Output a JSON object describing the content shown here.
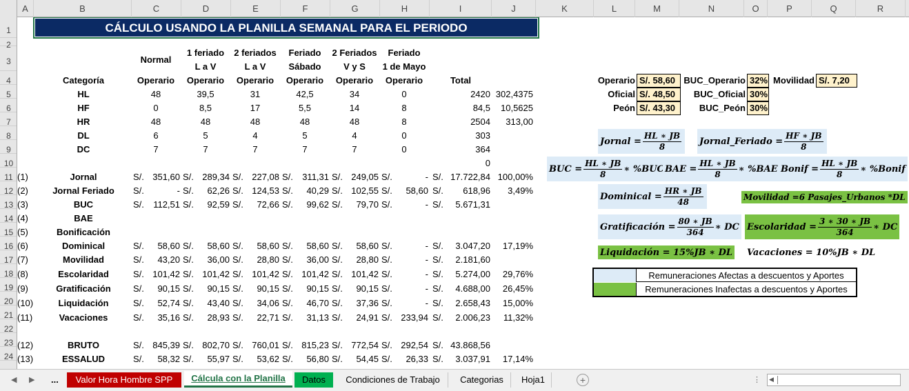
{
  "columns": [
    "A",
    "B",
    "C",
    "D",
    "E",
    "F",
    "G",
    "H",
    "I",
    "J",
    "K",
    "L",
    "M",
    "N",
    "O",
    "P",
    "Q",
    "R"
  ],
  "rows": [
    "1",
    "2",
    "3",
    "4",
    "5",
    "6",
    "7",
    "8",
    "9",
    "10",
    "11",
    "12",
    "13",
    "14",
    "15",
    "16",
    "17",
    "18",
    "19",
    "20",
    "21",
    "22",
    "23",
    "24"
  ],
  "title": "CÁLCULO USANDO LA PLANILLA SEMANAL PARA EL PERIODO",
  "headers": {
    "normal": "Normal",
    "f1a": "1 feriado",
    "f1b": "L a V",
    "f2a": "2 feriados",
    "f2b": "L a V",
    "fsa": "Feriado",
    "fsb": "Sábado",
    "fvsa": "2 Feriados",
    "fvsb": "V y S",
    "fma": "Feriado",
    "fmb": "1 de Mayo",
    "categoria": "Categoría",
    "operario": "Operario",
    "total": "Total"
  },
  "hours": [
    {
      "cat": "HL",
      "v": [
        "48",
        "39,5",
        "31",
        "42,5",
        "34",
        "0"
      ],
      "total": "2420",
      "j": "302,4375"
    },
    {
      "cat": "HF",
      "v": [
        "0",
        "8,5",
        "17",
        "5,5",
        "14",
        "8"
      ],
      "total": "84,5",
      "j": "10,5625"
    },
    {
      "cat": "HR",
      "v": [
        "48",
        "48",
        "48",
        "48",
        "48",
        "8"
      ],
      "total": "2504",
      "j": "313,00"
    },
    {
      "cat": "DL",
      "v": [
        "6",
        "5",
        "4",
        "5",
        "4",
        "0"
      ],
      "total": "303",
      "j": ""
    },
    {
      "cat": "DC",
      "v": [
        "7",
        "7",
        "7",
        "7",
        "7",
        "0"
      ],
      "total": "364",
      "j": ""
    }
  ],
  "row10_total": "0",
  "currency": "S/.",
  "items": [
    {
      "num": "(1)",
      "name": "Jornal",
      "v": [
        "351,60",
        "289,34",
        "227,08",
        "311,31",
        "249,05",
        "-"
      ],
      "total": "17.722,84",
      "pct": "100,00%"
    },
    {
      "num": "(2)",
      "name": "Jornal Feriado",
      "v": [
        "-",
        "62,26",
        "124,53",
        "40,29",
        "102,55",
        "58,60"
      ],
      "total": "618,96",
      "pct": "3,49%"
    },
    {
      "num": "(3)",
      "name": "BUC",
      "v": [
        "112,51",
        "92,59",
        "72,66",
        "99,62",
        "79,70",
        "-"
      ],
      "total": "5.671,31",
      "pct": ""
    },
    {
      "num": "(4)",
      "name": "BAE",
      "v": null,
      "total": "",
      "pct": ""
    },
    {
      "num": "(5)",
      "name": "Bonificación",
      "v": null,
      "total": "",
      "pct": ""
    },
    {
      "num": "(6)",
      "name": "Dominical",
      "v": [
        "58,60",
        "58,60",
        "58,60",
        "58,60",
        "58,60",
        "-"
      ],
      "total": "3.047,20",
      "pct": "17,19%"
    },
    {
      "num": "(7)",
      "name": "Movilidad",
      "v": [
        "43,20",
        "36,00",
        "28,80",
        "36,00",
        "28,80",
        "-"
      ],
      "total": "2.181,60",
      "pct": ""
    },
    {
      "num": "(8)",
      "name": "Escolaridad",
      "v": [
        "101,42",
        "101,42",
        "101,42",
        "101,42",
        "101,42",
        "-"
      ],
      "total": "5.274,00",
      "pct": "29,76%"
    },
    {
      "num": "(9)",
      "name": "Gratificación",
      "v": [
        "90,15",
        "90,15",
        "90,15",
        "90,15",
        "90,15",
        "-"
      ],
      "total": "4.688,00",
      "pct": "26,45%"
    },
    {
      "num": "(10)",
      "name": "Liquidación",
      "v": [
        "52,74",
        "43,40",
        "34,06",
        "46,70",
        "37,36",
        "-"
      ],
      "total": "2.658,43",
      "pct": "15,00%"
    },
    {
      "num": "(11)",
      "name": "Vacaciones",
      "v": [
        "35,16",
        "28,93",
        "22,71",
        "31,13",
        "24,91",
        "233,94"
      ],
      "total": "2.006,23",
      "pct": "11,32%"
    }
  ],
  "items2": [
    {
      "num": "(12)",
      "name": "BRUTO",
      "v": [
        "845,39",
        "802,70",
        "760,01",
        "815,23",
        "772,54",
        "292,54"
      ],
      "total": "43.868,56",
      "pct": ""
    },
    {
      "num": "(13)",
      "name": "ESSALUD",
      "v": [
        "58,32",
        "55,97",
        "53,62",
        "56,80",
        "54,45",
        "26,33"
      ],
      "total": "3.037,91",
      "pct": "17,14%"
    }
  ],
  "params": {
    "operario_l": "Operario",
    "operario_v": "S/. 58,60",
    "oficial_l": "Oficial",
    "oficial_v": "S/. 48,50",
    "peon_l": "Peón",
    "peon_v": "S/. 43,30",
    "buco_l": "BUC_Operario",
    "buco_v": "32%",
    "bucof_l": "BUC_Oficial",
    "bucof_v": "30%",
    "bucp_l": "BUC_Peón",
    "bucp_v": "30%",
    "mov_l": "Movilidad",
    "mov_v": "S/. 7,20"
  },
  "formulas": {
    "jornal": {
      "lhs": "Jornal =",
      "num": "HL ∗ JB",
      "den": "8",
      "rhs": ""
    },
    "jornal_feriado": {
      "lhs": "Jornal_Feriado =",
      "num": "HF ∗ JB",
      "den": "8",
      "rhs": ""
    },
    "buc": {
      "lhs": "BUC =",
      "num": "HL ∗ JB",
      "den": "8",
      "rhs": "∗ %BUC"
    },
    "bae": {
      "lhs": "BAE =",
      "num": "HL ∗ JB",
      "den": "8",
      "rhs": "∗ %BAE"
    },
    "bonif": {
      "lhs": "Bonif =",
      "num": "HL ∗ JB",
      "den": "8",
      "rhs": "∗ %Bonif"
    },
    "dominical": {
      "lhs": "Dominical =",
      "num": "HR ∗ JB",
      "den": "48",
      "rhs": ""
    },
    "movilidad": "Movilidad =6 Pasajes_Urbanos *DL",
    "gratificacion": {
      "lhs": "Gratificación =",
      "num": "80 ∗ JB",
      "den": "364",
      "rhs": "∗ DC"
    },
    "escolaridad": {
      "lhs": "Escolaridad =",
      "num": "3 ∗ 30 ∗ JB",
      "den": "364",
      "rhs": "∗ DC"
    },
    "liquidacion": "Liquidación = 15%JB ∗ DL",
    "vacaciones": "Vacaciones = 10%JB ∗ DL"
  },
  "legend": {
    "afectas": "Remuneraciones Afectas a descuentos y Aportes",
    "inafectas": "Remuneraciones Inafectas a descuentos y Aportes"
  },
  "tabs": {
    "more": "...",
    "t1": "Valor Hora Hombre SPP",
    "t2": "Cálcula con la Planilla",
    "t3": "Datos",
    "t4": "Condiciones de Trabajo",
    "t5": "Categorias",
    "t6": "Hoja1"
  },
  "colors": {
    "title_bg": "#0b2a64",
    "param_bg": "#fff2cc",
    "afecta": "#ddebf7",
    "inafecta": "#7ac143",
    "tab_red": "#c00000",
    "tab_green": "#00b050",
    "active_tab": "#217346"
  }
}
